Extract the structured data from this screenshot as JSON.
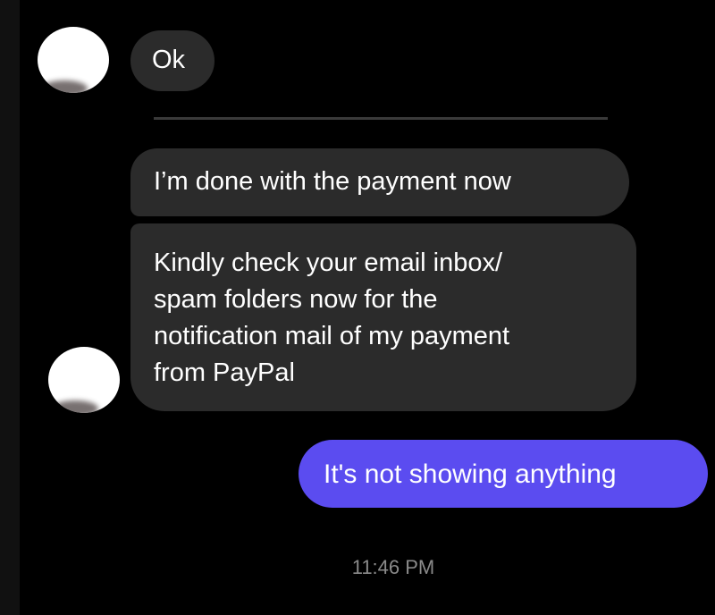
{
  "conversation": {
    "messages": [
      {
        "direction": "received",
        "text": "Ok"
      },
      {
        "direction": "received",
        "text": "I’m done with the payment now"
      },
      {
        "direction": "received",
        "text": "Kindly check your email inbox/\nspam folders now for the\nnotification mail of my payment\nfrom PayPal"
      },
      {
        "direction": "sent",
        "text": "It's not showing anything"
      }
    ],
    "timestamp": "11:46 PM"
  },
  "colors": {
    "background": "#000000",
    "received_bubble": "#2b2b2b",
    "sent_bubble": "#5b4cf0",
    "timestamp_text": "#8a8a8a"
  },
  "icons": {
    "avatar": "contact-avatar-icon"
  }
}
